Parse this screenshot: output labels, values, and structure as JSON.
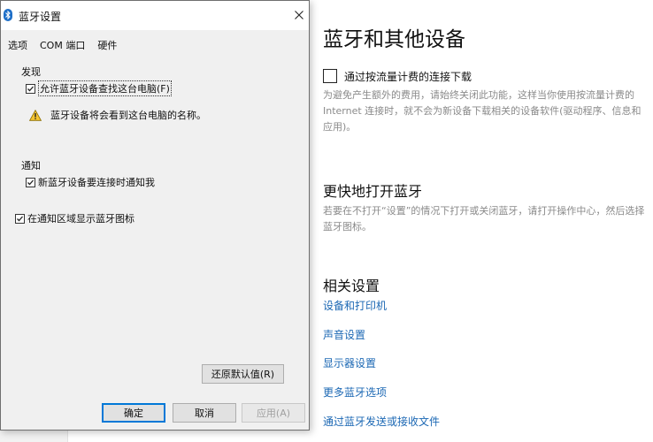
{
  "dialog": {
    "title": "蓝牙设置",
    "tabs": [
      "选项",
      "COM 端口",
      "硬件"
    ],
    "discovery": {
      "label": "发现",
      "allow_checkbox": "允许蓝牙设备查找这台电脑(F)",
      "allow_checked": true,
      "warning": "蓝牙设备将会看到这台电脑的名称。"
    },
    "notifications": {
      "label": "通知",
      "notify_checkbox": "新蓝牙设备要连接时通知我",
      "notify_checked": true
    },
    "tray_checkbox": "在通知区域显示蓝牙图标",
    "tray_checked": true,
    "restore_button": "还原默认值(R)",
    "ok_button": "确定",
    "cancel_button": "取消",
    "apply_button": "应用(A)"
  },
  "settings": {
    "title": "蓝牙和其他设备",
    "metered_checkbox": "通过按流量计费的连接下载",
    "metered_checked": false,
    "metered_desc": "为避免产生额外的费用，请始终关闭此功能，这样当你使用按流量计费的 Internet 连接时，就不会为新设备下载相关的设备软件(驱动程序、信息和应用)。",
    "quick_heading": "更快地打开蓝牙",
    "quick_desc": "若要在不打开“设置”的情况下打开或关闭蓝牙，请打开操作中心，然后选择蓝牙图标。",
    "related_heading": "相关设置",
    "related_links": [
      "设备和打印机",
      "声音设置",
      "显示器设置",
      "更多蓝牙选项",
      "通过蓝牙发送或接收文件"
    ]
  },
  "colors": {
    "link": "#1c68b4",
    "ok_border": "#0078d7",
    "muted_text": "#8a8a8a"
  },
  "icons": [
    "bluetooth-icon",
    "close-icon",
    "warning-icon",
    "checkmark-icon"
  ]
}
